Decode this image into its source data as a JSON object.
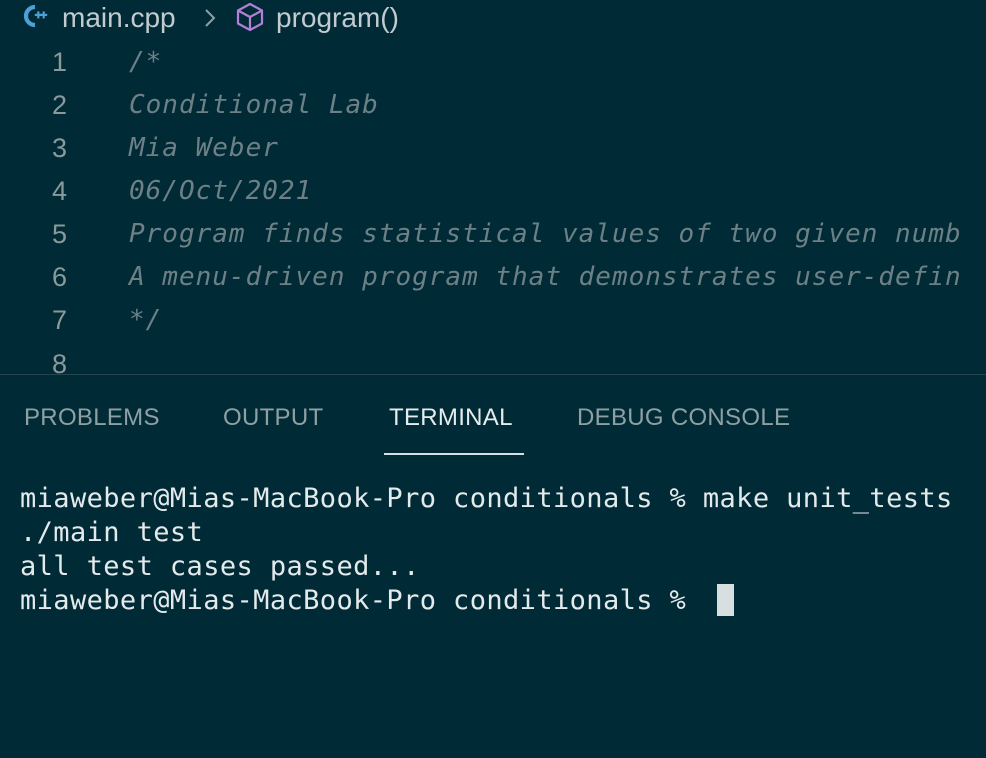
{
  "breadcrumb": {
    "file_icon": "cpp-file-icon",
    "file": "main.cpp",
    "separator_icon": "chevron-right-icon",
    "symbol_icon": "method-cube-icon",
    "symbol": "program()"
  },
  "editor": {
    "lines": [
      {
        "number": "1",
        "text": "/*"
      },
      {
        "number": "2",
        "text": "Conditional Lab"
      },
      {
        "number": "3",
        "text": "Mia Weber"
      },
      {
        "number": "4",
        "text": "06/Oct/2021"
      },
      {
        "number": "5",
        "text": "Program finds statistical values of two given numb"
      },
      {
        "number": "6",
        "text": "A menu-driven program that demonstrates user-defin"
      },
      {
        "number": "7",
        "text": "*/"
      },
      {
        "number": "8",
        "text": ""
      }
    ]
  },
  "panel": {
    "tabs": [
      {
        "label": "PROBLEMS",
        "active": false
      },
      {
        "label": "OUTPUT",
        "active": false
      },
      {
        "label": "TERMINAL",
        "active": true
      },
      {
        "label": "DEBUG CONSOLE",
        "active": false
      }
    ]
  },
  "terminal": {
    "lines": [
      "miaweber@Mias-MacBook-Pro conditionals % make unit_tests",
      "./main test",
      "all test cases passed...",
      "miaweber@Mias-MacBook-Pro conditionals % "
    ]
  },
  "colors": {
    "background": "#002b36",
    "cpp_icon": "#4f9ed7",
    "method_icon": "#b180d7",
    "comment": "#6c8086"
  }
}
